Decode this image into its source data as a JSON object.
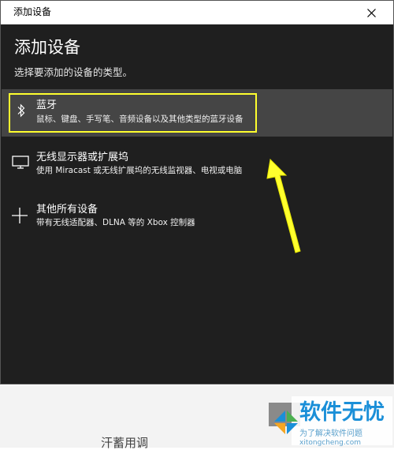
{
  "window": {
    "title": "添加设备",
    "close_label": "×"
  },
  "page": {
    "heading": "添加设备",
    "subtitle": "选择要添加的设备的类型。"
  },
  "options": [
    {
      "label": "蓝牙",
      "desc": "鼠标、键盘、手写笔、音频设备以及其他类型的蓝牙设备",
      "icon": "bluetooth-icon",
      "selected": true
    },
    {
      "label": "无线显示器或扩展坞",
      "desc": "使用 Miracast 或无线扩展坞的无线监视器、电视或电脑",
      "icon": "monitor-icon",
      "selected": false
    },
    {
      "label": "其他所有设备",
      "desc": "带有无线适配器、DLNA 等的 Xbox 控制器",
      "icon": "plus-icon",
      "selected": false
    }
  ],
  "background": {
    "partial_text": "汗蓄用调"
  },
  "watermark": {
    "title": "软件无忧",
    "subtitle": "为了解决软件问题",
    "url": "xitongcheng.com"
  },
  "colors": {
    "dialog_bg": "#1f1f1f",
    "selected_bg": "#454545",
    "highlight": "#ffff2e",
    "arrow": "#ffff2e",
    "watermark_blue": "#1a8fd8"
  }
}
